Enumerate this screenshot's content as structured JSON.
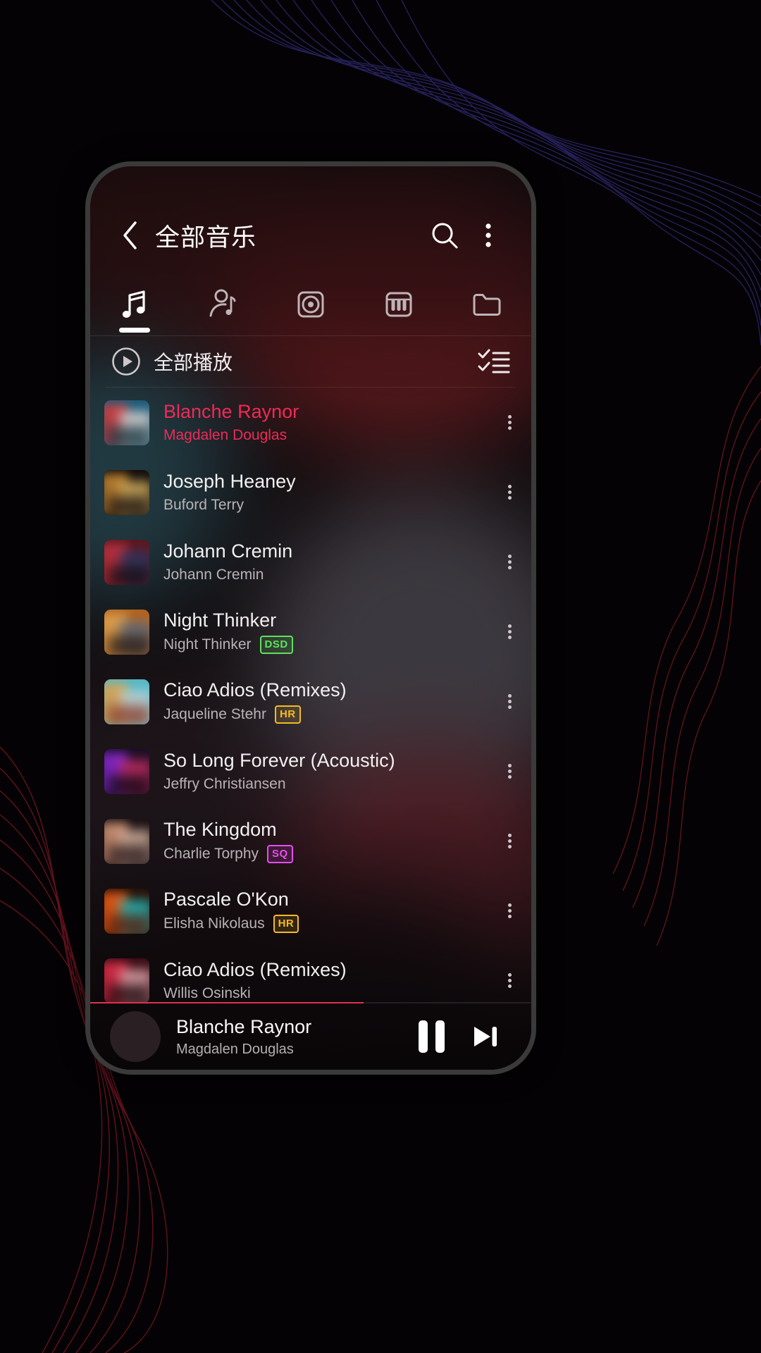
{
  "app": {
    "title": "全部音乐",
    "back_icon": "chevron-left-icon",
    "search_icon": "search-icon",
    "overflow_icon": "more-vertical-icon"
  },
  "tabs": [
    {
      "id": "songs",
      "icon": "music-note-icon",
      "active": true
    },
    {
      "id": "artists",
      "icon": "artist-icon",
      "active": false
    },
    {
      "id": "albums",
      "icon": "album-disc-icon",
      "active": false
    },
    {
      "id": "genres",
      "icon": "piano-keys-icon",
      "active": false
    },
    {
      "id": "folders",
      "icon": "folder-icon",
      "active": false
    }
  ],
  "play_all": {
    "label": "全部播放",
    "play_icon": "play-circle-icon",
    "multiselect_icon": "checklist-icon"
  },
  "songs": [
    {
      "title": "Blanche Raynor",
      "artist": "Magdalen Douglas",
      "badge": "",
      "playing": true,
      "art": [
        "#1d5a78",
        "#d83b3b",
        "#efe3dd",
        "#17343f"
      ]
    },
    {
      "title": "Joseph Heaney",
      "artist": "Buford Terry",
      "badge": "",
      "playing": false,
      "art": [
        "#120d0c",
        "#c98a34",
        "#e8c36a",
        "#1a1210"
      ]
    },
    {
      "title": "Johann Cremin",
      "artist": "Johann Cremin",
      "badge": "",
      "playing": false,
      "art": [
        "#5c1820",
        "#c23340",
        "#2b3b6b",
        "#1a0d12"
      ]
    },
    {
      "title": "Night Thinker",
      "artist": "Night Thinker",
      "badge": "DSD",
      "playing": false,
      "art": [
        "#b4641f",
        "#e0a451",
        "#5a6e86",
        "#2b1c14"
      ]
    },
    {
      "title": "Ciao Adios (Remixes)",
      "artist": "Jaqueline Stehr",
      "badge": "HR",
      "playing": false,
      "art": [
        "#56b8c4",
        "#e2a04a",
        "#c7d6d9",
        "#8b3c2a"
      ]
    },
    {
      "title": "So Long Forever (Acoustic)",
      "artist": "Jeffry Christiansen",
      "badge": "",
      "playing": false,
      "art": [
        "#1b0f26",
        "#8d2ad6",
        "#d6326a",
        "#0d0712"
      ]
    },
    {
      "title": "The Kingdom",
      "artist": "Charlie Torphy",
      "badge": "SQ",
      "playing": false,
      "art": [
        "#1a1113",
        "#d99a7a",
        "#e6c3ad",
        "#2a1a1c"
      ]
    },
    {
      "title": "Pascale O'Kon",
      "artist": "Elisha Nikolaus",
      "badge": "HR",
      "playing": false,
      "art": [
        "#2a0f06",
        "#f2601a",
        "#27c9c9",
        "#581a08"
      ]
    },
    {
      "title": "Ciao Adios (Remixes)",
      "artist": "Willis Osinski",
      "badge": "",
      "playing": false,
      "art": [
        "#3a0c14",
        "#e12f4a",
        "#f0b7bd",
        "#190509"
      ]
    }
  ],
  "now_playing": {
    "title": "Blanche Raynor",
    "artist": "Magdalen Douglas",
    "pause_icon": "pause-icon",
    "next_icon": "skip-next-icon",
    "progress_percent": 62,
    "art": [
      "#1d5a78",
      "#d83b3b",
      "#efe3dd",
      "#17343f"
    ]
  },
  "colors": {
    "accent": "#ef2a56",
    "progress": "#e03050",
    "badge_dsd": "#5fe05f",
    "badge_hr": "#f2bb28",
    "badge_sq": "#e54df0",
    "text_primary": "#f3f0f1",
    "text_secondary": "#b9b2b5"
  }
}
